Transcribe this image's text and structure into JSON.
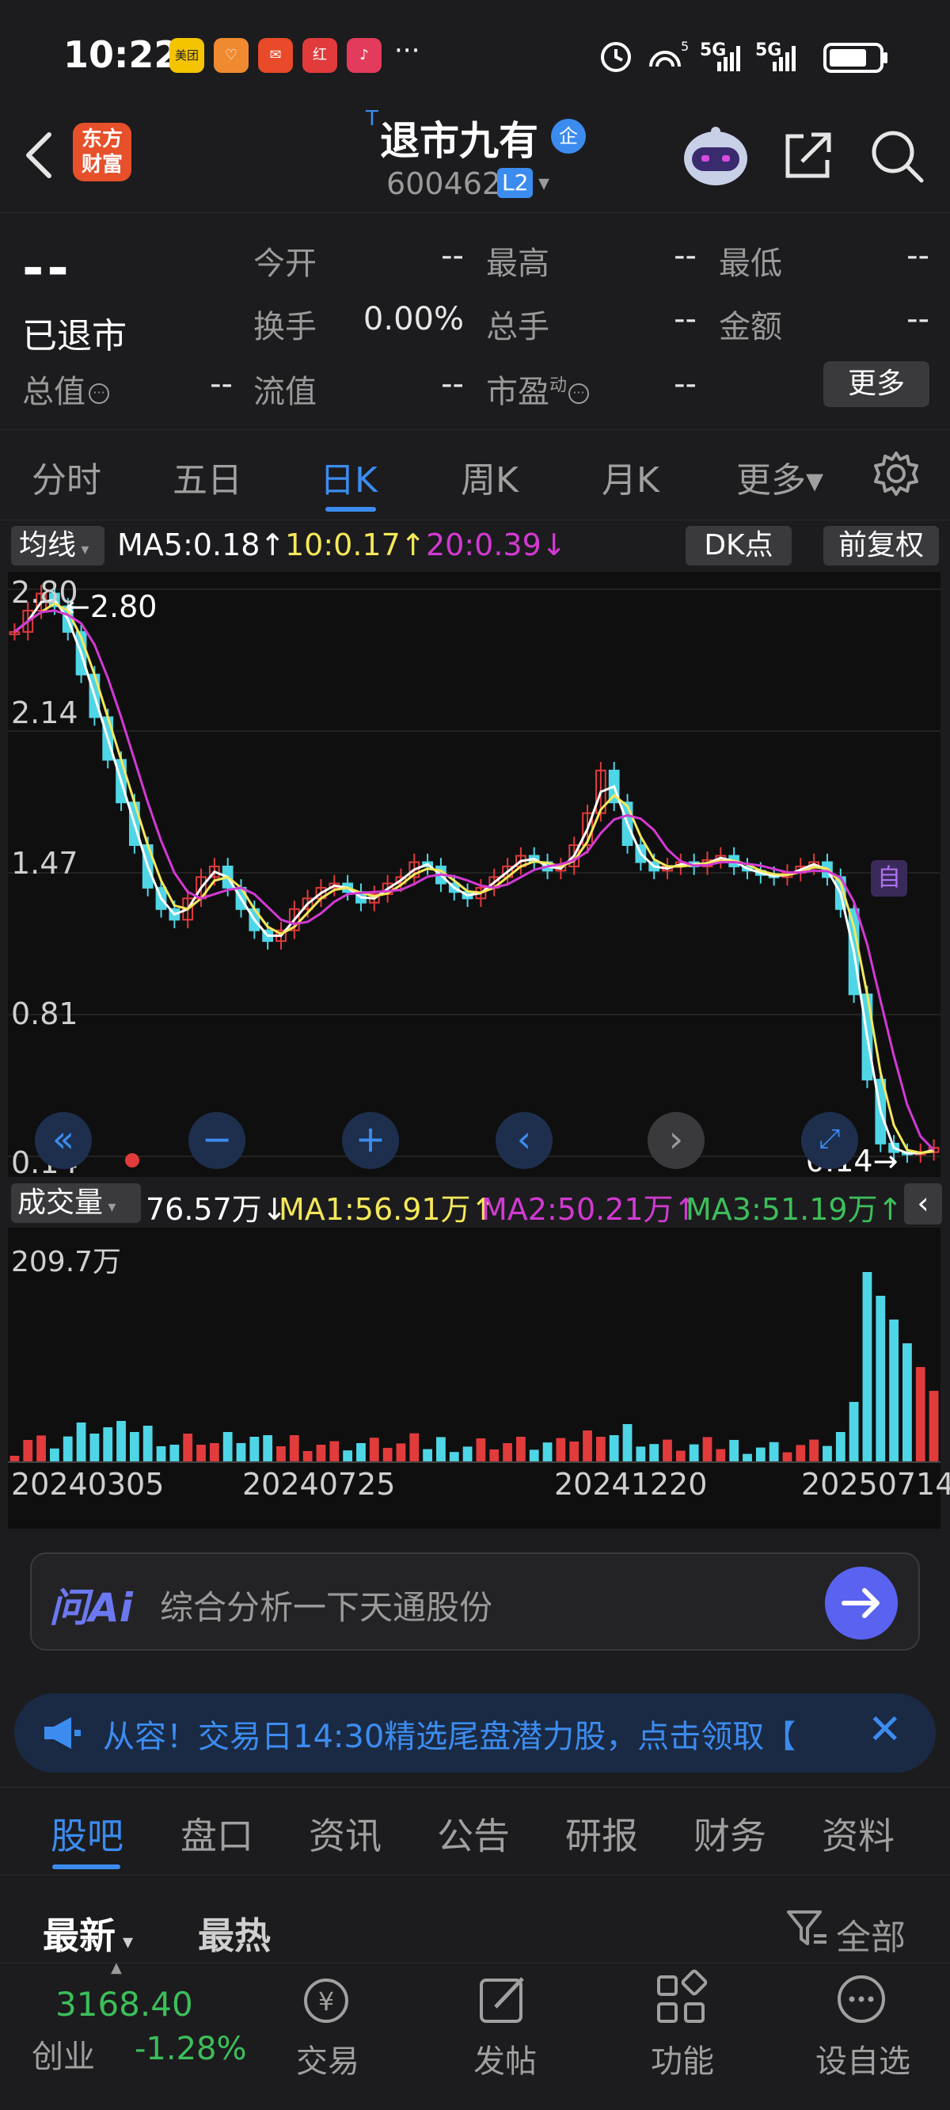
{
  "status": {
    "time": "10:22",
    "apps": [
      "美团",
      "♡",
      "✉",
      "红",
      "♪"
    ],
    "more": "···",
    "net": "5G 5G"
  },
  "header": {
    "brand": "东方财富",
    "stock_name_prefix": "T",
    "stock_name": "退市九有",
    "enterprise_badge": "企",
    "stock_code": "600462",
    "level_badge": "L2"
  },
  "quote": {
    "price": "--",
    "status_label": "已退市",
    "rows": [
      {
        "l1": "今开",
        "v1": "--",
        "l2": "最高",
        "v2": "--",
        "l3": "最低",
        "v3": "--"
      },
      {
        "l1": "换手",
        "v1": "0.00%",
        "l2": "总手",
        "v2": "--",
        "l3": "金额",
        "v3": "--"
      },
      {
        "l0": "总值",
        "v0": "--",
        "l1": "流值",
        "v1": "--",
        "l2": "市盈",
        "v2": "--",
        "sup": "动"
      }
    ],
    "more_label": "更多"
  },
  "period_tabs": [
    {
      "label": "分时"
    },
    {
      "label": "五日"
    },
    {
      "label": "日K",
      "active": true
    },
    {
      "label": "周K"
    },
    {
      "label": "月K"
    },
    {
      "label": "更多▾"
    }
  ],
  "ma": {
    "selector": "均线",
    "ma5": "MA5:0.18↑",
    "ma10": "10:0.17↑",
    "ma20": "20:0.39↓",
    "dk": "DK点",
    "adjust": "前复权"
  },
  "chart_data": {
    "type": "candlestick",
    "y_ticks": [
      "2.80",
      "2.14",
      "1.47",
      "0.81",
      "0.14"
    ],
    "ylim": [
      0.14,
      2.8
    ],
    "x_ticks": [
      "20240305",
      "20240725",
      "20241220",
      "20250714"
    ],
    "high_marker": "2.80",
    "low_marker": "0.14",
    "self_select_marker": "自",
    "close_series": [
      2.6,
      2.7,
      2.78,
      2.72,
      2.6,
      2.4,
      2.2,
      2.0,
      1.8,
      1.6,
      1.4,
      1.3,
      1.25,
      1.35,
      1.45,
      1.5,
      1.4,
      1.3,
      1.2,
      1.15,
      1.2,
      1.3,
      1.35,
      1.4,
      1.42,
      1.38,
      1.33,
      1.37,
      1.42,
      1.45,
      1.52,
      1.5,
      1.42,
      1.38,
      1.35,
      1.4,
      1.45,
      1.5,
      1.55,
      1.52,
      1.48,
      1.5,
      1.6,
      1.75,
      1.95,
      1.8,
      1.6,
      1.52,
      1.48,
      1.5,
      1.52,
      1.5,
      1.53,
      1.55,
      1.5,
      1.48,
      1.46,
      1.45,
      1.47,
      1.5,
      1.52,
      1.45,
      1.3,
      0.9,
      0.5,
      0.2,
      0.16,
      0.15,
      0.16,
      0.18
    ],
    "volume": {
      "label": "成交量",
      "current": "76.57万↓",
      "ma1": "MA1:56.91万↑",
      "ma2": "MA2:50.21万↑",
      "ma3": "MA3:51.19万↑",
      "max_tick": "209.7万"
    }
  },
  "ai": {
    "logo": "问Ai",
    "placeholder": "综合分析一下天通股份"
  },
  "notice": {
    "text": "从容！交易日14:30精选尾盘潜力股，点击领取【"
  },
  "info_tabs": [
    {
      "label": "股吧",
      "active": true
    },
    {
      "label": "盘口"
    },
    {
      "label": "资讯"
    },
    {
      "label": "公告"
    },
    {
      "label": "研报"
    },
    {
      "label": "财务"
    },
    {
      "label": "资料"
    }
  ],
  "sort": {
    "newest": "最新",
    "hottest": "最热",
    "filter": "全部"
  },
  "bottom_nav": {
    "index_value": "3168.40",
    "index_name": "创业",
    "index_change": "-1.28%",
    "items": [
      "交易",
      "发帖",
      "功能",
      "设自选"
    ]
  }
}
